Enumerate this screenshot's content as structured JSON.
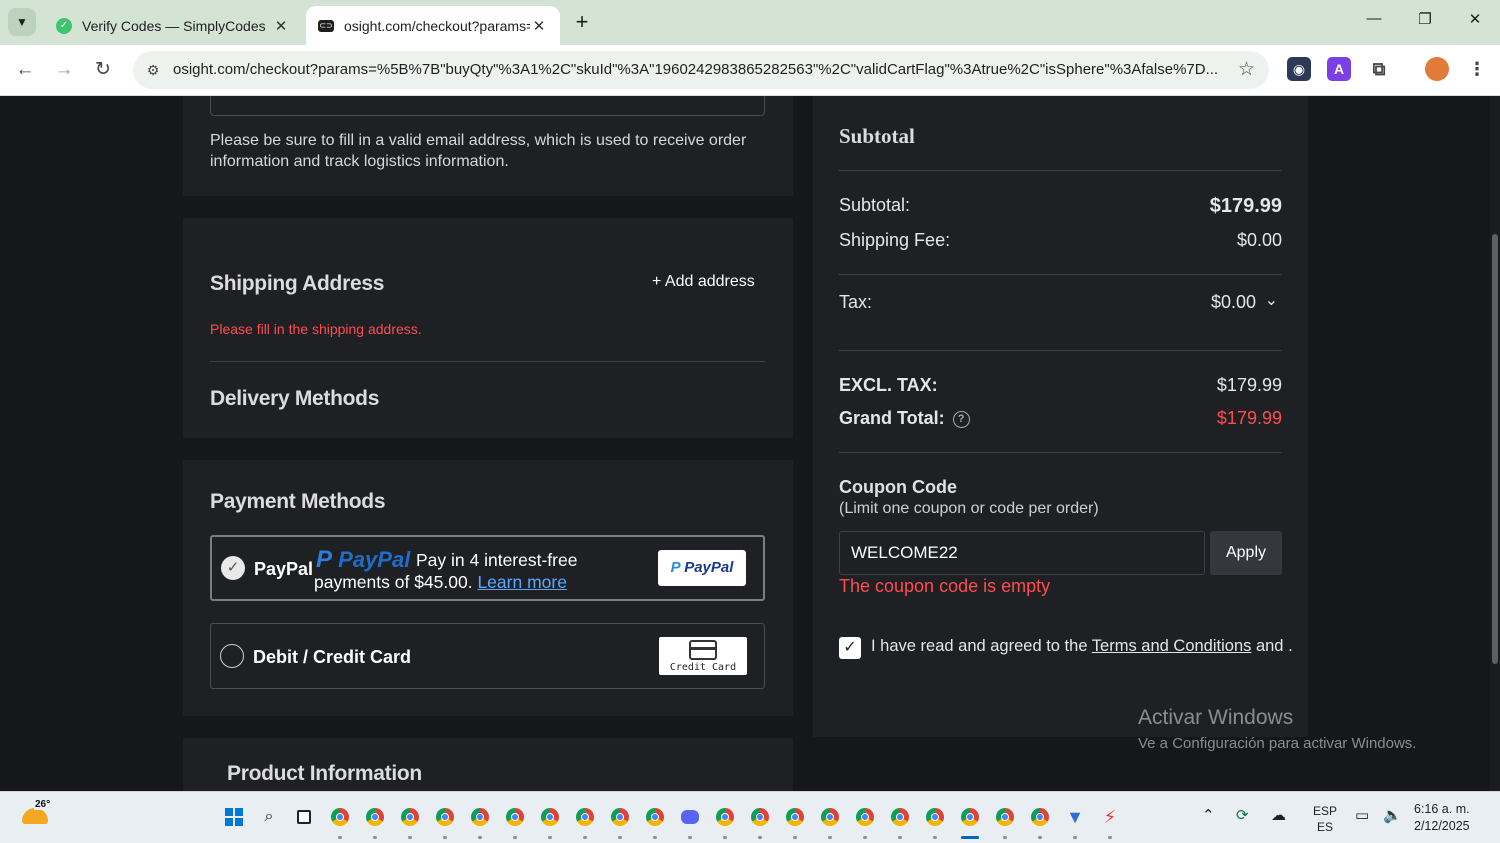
{
  "browser": {
    "tabs": [
      {
        "title": "Verify Codes — SimplyCodes",
        "favicon": "simplycodes-icon"
      },
      {
        "title": "osight.com/checkout?params=%",
        "favicon": "site-icon"
      }
    ],
    "url": "osight.com/checkout?params=%5B%7B\"buyQty\"%3A1%2C\"skuId\"%3A\"1960242983865282563\"%2C\"validCartFlag\"%3Atrue%2C\"isSphere\"%3Afalse%7D...",
    "new_tab_glyph": "+",
    "window_controls": {
      "minimize": "—",
      "restore": "❐",
      "close": "✕"
    }
  },
  "email_section": {
    "hint": "Please be sure to fill in a valid email address, which is used to receive order information and track logistics information."
  },
  "shipping": {
    "title": "Shipping Address",
    "add_label": "+ Add address",
    "error": "Please fill in the shipping address."
  },
  "delivery": {
    "title": "Delivery Methods"
  },
  "payment": {
    "title": "Payment Methods",
    "paypal": {
      "label": "PayPal",
      "logo_text": "PayPal",
      "promo_text": "Pay in 4 interest-free payments of $45.00.",
      "learn_more": "Learn more",
      "button_text": "PayPal"
    },
    "card": {
      "label": "Debit / Credit Card",
      "button_text": "Credit Card"
    }
  },
  "product": {
    "title": "Product Information"
  },
  "summary": {
    "title": "Subtotal",
    "subtotal_label": "Subtotal:",
    "subtotal_value": "$179.99",
    "shipping_label": "Shipping Fee:",
    "shipping_value": "$0.00",
    "tax_label": "Tax:",
    "tax_value": "$0.00",
    "excl_label": "EXCL. TAX:",
    "excl_value": "$179.99",
    "grand_label": "Grand Total:",
    "grand_value": "$179.99"
  },
  "coupon": {
    "title": "Coupon Code",
    "subtitle": "(Limit one coupon or code per order)",
    "value": "WELCOME22",
    "apply_label": "Apply",
    "error": "The coupon code is empty"
  },
  "agreement": {
    "checked": true,
    "prefix": "I have read and agreed to the ",
    "link": "Terms and Conditions",
    "suffix": " and ."
  },
  "watermark": {
    "title": "Activar Windows",
    "subtitle": "Ve a Configuración para activar Windows."
  },
  "taskbar": {
    "weather_temp": "26°",
    "lang_top": "ESP",
    "lang_bottom": "ES",
    "time": "6:16 a. m.",
    "date": "2/12/2025"
  },
  "colors": {
    "background": "#15171b",
    "panel": "#1e2024",
    "error_red": "#ff4d4f",
    "link_blue": "#5aa9ff",
    "paypal_blue": "#1e6ec9"
  }
}
